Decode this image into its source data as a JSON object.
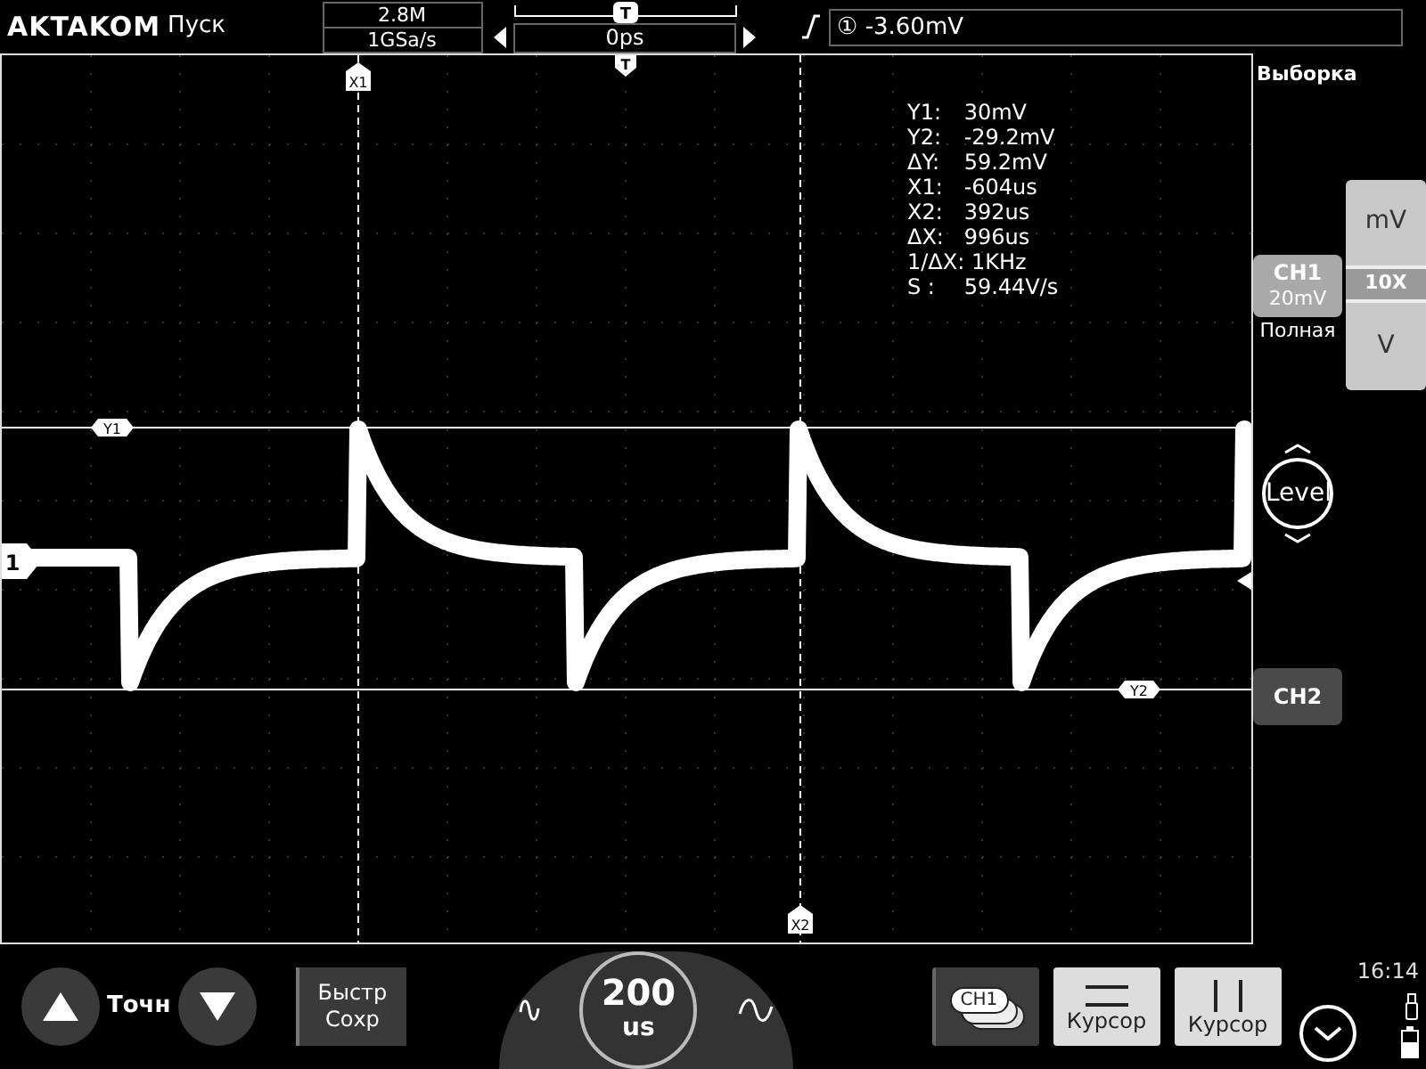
{
  "header": {
    "logo": "AKTAKOM",
    "run_state": "Пуск",
    "memory_depth": "2.8M",
    "sample_rate": "1GSa/s",
    "trigger_marker": "T",
    "horizontal_position": "0ps",
    "trigger_channel": "①",
    "trigger_level": "-3.60mV"
  },
  "screen": {
    "trigger_position_marker": "T",
    "channel_marker": "1",
    "x_cursors": [
      {
        "label": "X1"
      },
      {
        "label": "X2"
      }
    ],
    "y_cursors": [
      {
        "label": "Y1"
      },
      {
        "label": "Y2"
      }
    ],
    "measurements": [
      {
        "label": "Y1:",
        "value": "30mV"
      },
      {
        "label": "Y2:",
        "value": "-29.2mV"
      },
      {
        "label": "ΔY:",
        "value": "59.2mV"
      },
      {
        "label": "X1:",
        "value": "-604us"
      },
      {
        "label": "X2:",
        "value": "392us"
      },
      {
        "label": "ΔX:",
        "value": "996us"
      },
      {
        "label": "1/ΔX:",
        "value": "1KHz"
      },
      {
        "label": "S :",
        "value": "59.44V/s"
      }
    ]
  },
  "side_panel": {
    "acquisition_mode": "Выборка",
    "channels": [
      {
        "label": "CH1",
        "scale": "20mV",
        "selected": true
      },
      {
        "label": "CH2",
        "selected": false
      }
    ],
    "bandwidth": "Полная",
    "units": [
      "mV",
      "10X",
      "V"
    ],
    "trigger_level_knob": "Level"
  },
  "bottom_bar": {
    "fine_label": "Точн",
    "quick_save": [
      "Быстр",
      "Сохр"
    ],
    "timebase_value": "200",
    "timebase_unit": "us",
    "tools": [
      {
        "kind": "source",
        "label": "CH1",
        "selected": false
      },
      {
        "kind": "horizontal",
        "label": "Курсор",
        "selected": true
      },
      {
        "kind": "vertical",
        "label": "Курсор",
        "selected": true
      }
    ],
    "clock": "16:14"
  }
}
